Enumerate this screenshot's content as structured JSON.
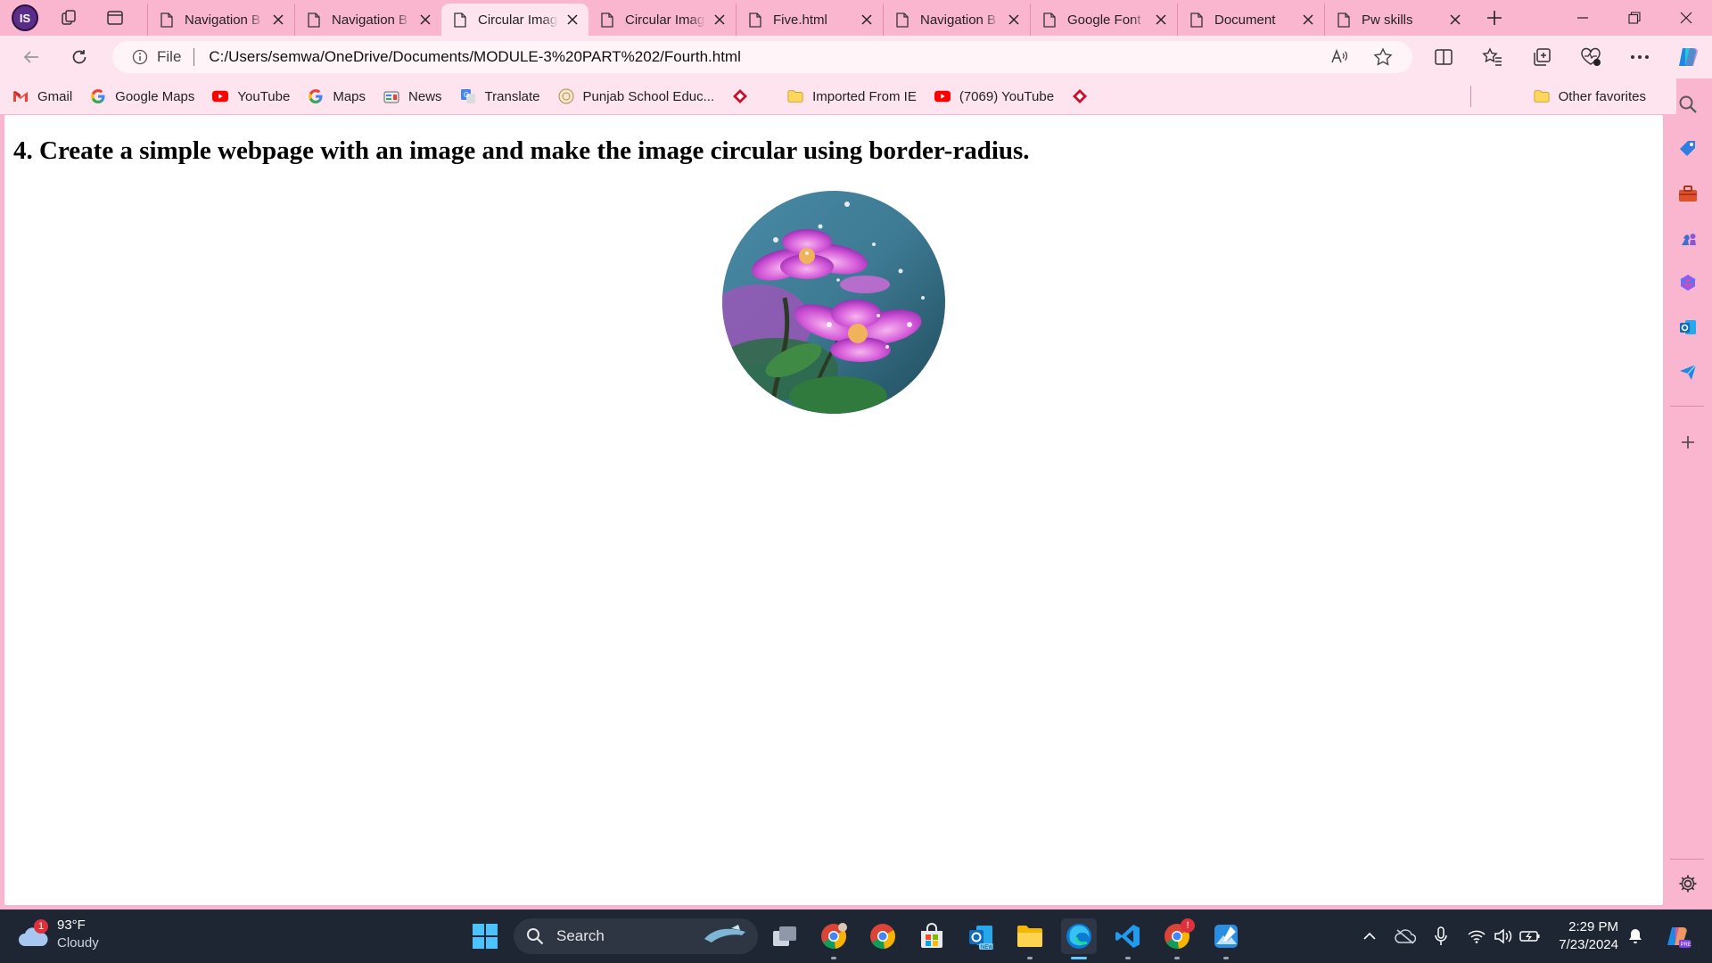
{
  "browser": {
    "profile_initials": "IS",
    "tabs": [
      {
        "label": "Navigation B",
        "active": false
      },
      {
        "label": "Navigation B",
        "active": false
      },
      {
        "label": "Circular Imag",
        "active": true
      },
      {
        "label": "Circular Imag",
        "active": false
      },
      {
        "label": "Five.html",
        "active": false
      },
      {
        "label": "Navigation B",
        "active": false
      },
      {
        "label": "Google Font",
        "active": false
      },
      {
        "label": "Document",
        "active": false
      },
      {
        "label": "Pw skills",
        "active": false
      }
    ],
    "address": {
      "scheme_label": "File",
      "url": "C:/Users/semwa/OneDrive/Documents/MODULE-3%20PART%202/Fourth.html"
    },
    "favorites": [
      {
        "label": "Gmail",
        "icon": "gmail-icon"
      },
      {
        "label": "Google Maps",
        "icon": "google-icon"
      },
      {
        "label": "YouTube",
        "icon": "youtube-icon"
      },
      {
        "label": "Maps",
        "icon": "google-icon"
      },
      {
        "label": "News",
        "icon": "news-icon"
      },
      {
        "label": "Translate",
        "icon": "translate-icon"
      },
      {
        "label": "Punjab School Educ...",
        "icon": "punjab-icon"
      },
      {
        "label": "Imported From IE",
        "icon": "folder-icon"
      },
      {
        "label": "(7069) YouTube",
        "icon": "youtube-icon"
      }
    ],
    "other_favorites_label": "Other favorites"
  },
  "page": {
    "heading": "4. Create a simple webpage with an image and make the image circular using border-radius."
  },
  "taskbar": {
    "weather_temp": "93°F",
    "weather_desc": "Cloudy",
    "weather_badge": "1",
    "search_label": "Search",
    "time": "2:29 PM",
    "date": "7/23/2024",
    "chrome_badge": "!"
  },
  "colors": {
    "chrome_pink": "#fbb6cf",
    "toolbar_pink": "#fde4ee",
    "taskbar": "#1f2633",
    "accent_blue": "#0078d4"
  }
}
